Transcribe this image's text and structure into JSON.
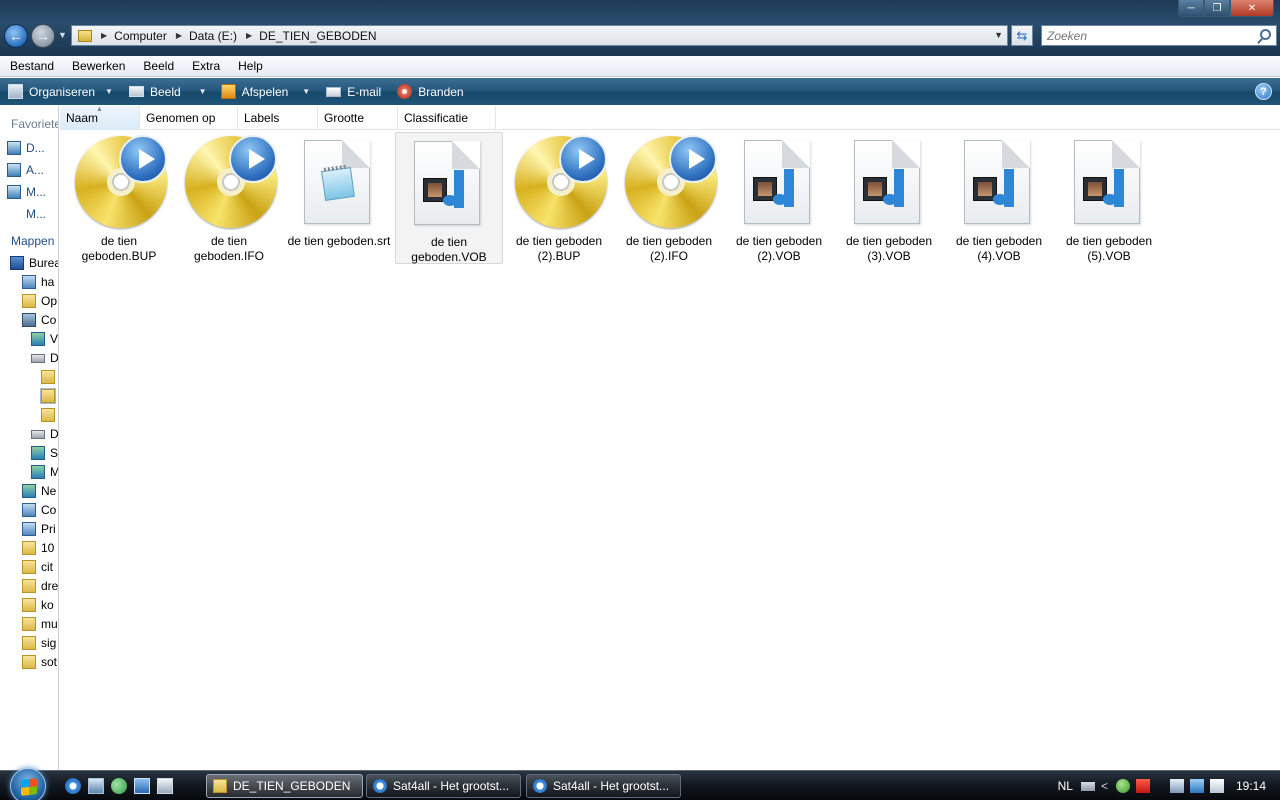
{
  "window": {
    "minimize_glyph": "─",
    "maximize_glyph": "❐",
    "close_glyph": "✕"
  },
  "nav": {
    "back_glyph": "←",
    "forward_glyph": "→",
    "dropdown_glyph": "▼"
  },
  "address": {
    "crumbs": [
      "Computer",
      "Data (E:)",
      "DE_TIEN_GEBODEN"
    ],
    "separator": "▶"
  },
  "search": {
    "placeholder": "Zoeken"
  },
  "menu": [
    "Bestand",
    "Bewerken",
    "Beeld",
    "Extra",
    "Help"
  ],
  "commands": [
    {
      "label": "Organiseren",
      "icon": "organize-icon",
      "has_menu": true
    },
    {
      "label": "Beeld",
      "icon": "views-icon",
      "has_menu": true
    },
    {
      "label": "Afspelen",
      "icon": "play-icon",
      "has_menu": true
    },
    {
      "label": "E-mail",
      "icon": "email-icon",
      "has_menu": false
    },
    {
      "label": "Branden",
      "icon": "burn-icon",
      "has_menu": false
    }
  ],
  "help_glyph": "?",
  "navpane": {
    "favorites_heading": "Favoriete koppelingen",
    "favorites": [
      "D...",
      "A...",
      "M...",
      "M..."
    ],
    "folders_heading": "Mappen",
    "tree": [
      {
        "label": "Bureaublad",
        "indent": 0,
        "icon": "desktop-icon"
      },
      {
        "label": "ha",
        "indent": 1,
        "icon": "user-folder-icon"
      },
      {
        "label": "Op",
        "indent": 1,
        "icon": "folder-icon"
      },
      {
        "label": "Co",
        "indent": 1,
        "icon": "computer-icon"
      },
      {
        "label": "V",
        "indent": 2,
        "icon": "drive-icon"
      },
      {
        "label": "D",
        "indent": 2,
        "icon": "drive-icon"
      },
      {
        "label": "",
        "indent": 3,
        "icon": "folder-icon"
      },
      {
        "label": "",
        "indent": 3,
        "icon": "folder-icon"
      },
      {
        "label": "",
        "indent": 3,
        "icon": "folder-icon"
      },
      {
        "label": "D",
        "indent": 2,
        "icon": "dvd-drive-icon"
      },
      {
        "label": "S",
        "indent": 2,
        "icon": "network-drive-icon"
      },
      {
        "label": "M",
        "indent": 2,
        "icon": "network-drive-icon"
      },
      {
        "label": "Ne",
        "indent": 1,
        "icon": "network-icon"
      },
      {
        "label": "Co",
        "indent": 1,
        "icon": "control-panel-icon"
      },
      {
        "label": "Pri",
        "indent": 1,
        "icon": "recycle-bin-icon"
      },
      {
        "label": "10",
        "indent": 1,
        "icon": "folder-icon"
      },
      {
        "label": "cit",
        "indent": 1,
        "icon": "folder-icon"
      },
      {
        "label": "dre",
        "indent": 1,
        "icon": "folder-icon"
      },
      {
        "label": "ko",
        "indent": 1,
        "icon": "folder-icon"
      },
      {
        "label": "mu",
        "indent": 1,
        "icon": "folder-icon"
      },
      {
        "label": "sig",
        "indent": 1,
        "icon": "folder-icon"
      },
      {
        "label": "sot",
        "indent": 1,
        "icon": "folder-icon"
      }
    ]
  },
  "columns": [
    "Naam",
    "Genomen op",
    "Labels",
    "Grootte",
    "Classificatie"
  ],
  "sort_glyph": "▲",
  "files": [
    {
      "name": "de tien geboden.BUP",
      "icon": "dvd-disc-icon",
      "selected": false
    },
    {
      "name": "de tien geboden.IFO",
      "icon": "dvd-disc-icon",
      "selected": false
    },
    {
      "name": "de tien geboden.srt",
      "icon": "text-document-icon",
      "selected": false
    },
    {
      "name": "de tien geboden.VOB",
      "icon": "media-file-icon",
      "selected": true
    },
    {
      "name": "de tien geboden (2).BUP",
      "icon": "dvd-disc-icon",
      "selected": false
    },
    {
      "name": "de tien geboden (2).IFO",
      "icon": "dvd-disc-icon",
      "selected": false
    },
    {
      "name": "de tien geboden (2).VOB",
      "icon": "media-file-icon",
      "selected": false
    },
    {
      "name": "de tien geboden (3).VOB",
      "icon": "media-file-icon",
      "selected": false
    },
    {
      "name": "de tien geboden (4).VOB",
      "icon": "media-file-icon",
      "selected": false
    },
    {
      "name": "de tien geboden (5).VOB",
      "icon": "media-file-icon",
      "selected": false
    }
  ],
  "taskbar": {
    "quicklaunch": [
      "ie-icon",
      "show-desktop-icon",
      "users-icon",
      "monitor-icon",
      "calculator-icon"
    ],
    "tasks": [
      {
        "label": "DE_TIEN_GEBODEN",
        "icon": "folder-icon",
        "active": true
      },
      {
        "label": "Sat4all - Het grootst...",
        "icon": "ie-icon",
        "active": false
      },
      {
        "label": "Sat4all - Het grootst...",
        "icon": "ie-icon",
        "active": false
      }
    ],
    "language": "NL",
    "tray_chevron": "<",
    "clock": "19:14"
  },
  "colors": {
    "accent": "#1e4f87",
    "command_bar": "#24567c",
    "selection": "#f3f3f3"
  }
}
